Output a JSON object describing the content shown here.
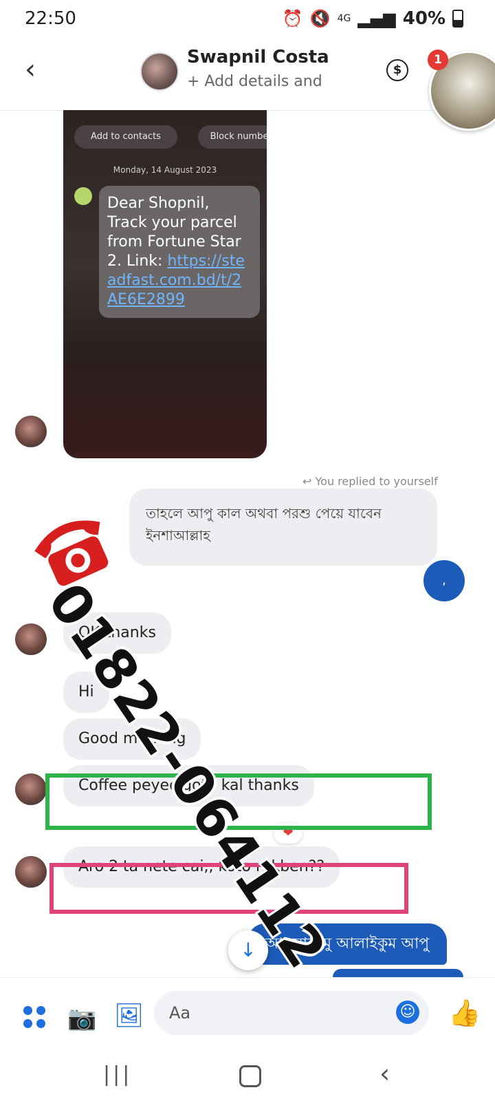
{
  "status_bar": {
    "time": "22:50",
    "signal_label": "4G",
    "battery": "40%"
  },
  "header": {
    "contact_name": "Swapnil Costa",
    "contact_subtitle": "+ Add details and",
    "chat_head_badge": "1"
  },
  "image_message": {
    "add_contacts": "Add to contacts",
    "block_number": "Block numbe",
    "date": "Monday, 14 August 2023",
    "sms_text": "Dear Shopnil, Track your parcel from Fortune Star 2.  Link: ",
    "sms_link": "https://steadfast.com.bd/t/2AE6E2899"
  },
  "messages": {
    "replied_note": "You replied to yourself",
    "outgoing_reply": "তাহলে আপু কাল অথবা পরশু পেয়ে যাবেন ইনশাআল্লাহ",
    "outgoing_dot": ",",
    "ok_thanks": "OK thanks",
    "hi": "Hi",
    "good_morning": "Good morning",
    "coffee": "Coffee peyec goto kal thanks",
    "reaction": "❤",
    "aro": "Aro 2 ta nete cai,, koto rakben??",
    "salam": "আসসালামু আলাইকুম আপু"
  },
  "watermark": {
    "phone_number": "01822-064112"
  },
  "composer": {
    "placeholder": "Aa"
  },
  "colors": {
    "accent": "#1d6fe0",
    "outgoing": "#1d5bb8",
    "green_box": "#2db34a",
    "pink_box": "#e0427a"
  }
}
